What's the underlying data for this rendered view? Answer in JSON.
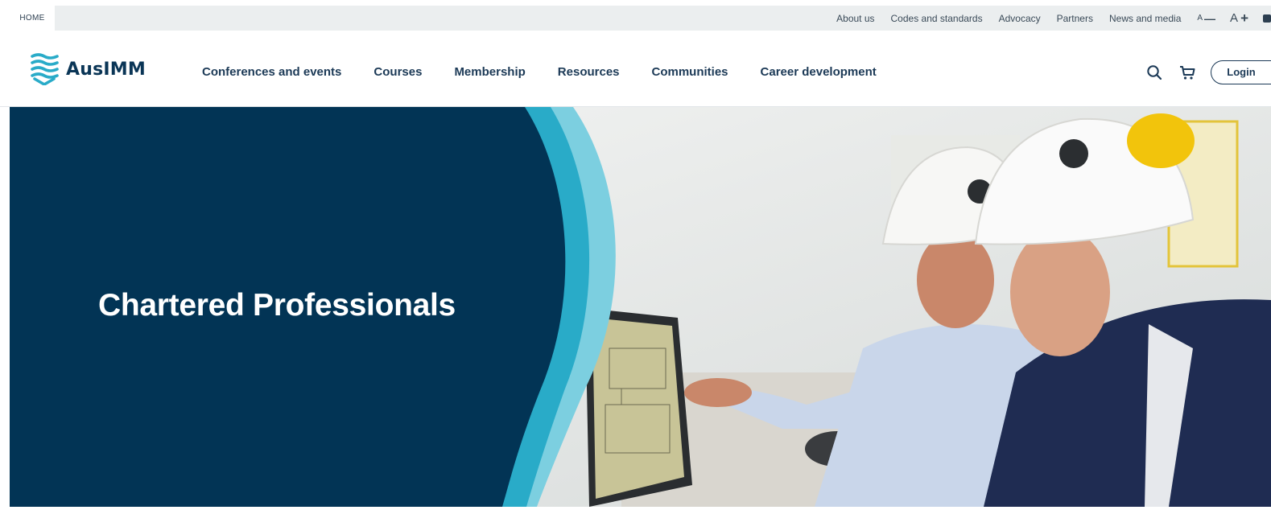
{
  "utility_bar": {
    "home_label": "HOME",
    "links": [
      "About us",
      "Codes and standards",
      "Advocacy",
      "Partners",
      "News and media"
    ],
    "font_decrease": {
      "letter": "A",
      "symbol": "—"
    },
    "font_increase": {
      "letter": "A",
      "symbol": "+"
    }
  },
  "header": {
    "logo_text": "AusIMM",
    "nav": [
      "Conferences and events",
      "Courses",
      "Membership",
      "Resources",
      "Communities",
      "Career development"
    ],
    "login_label": "Login"
  },
  "hero": {
    "title": "Chartered Professionals"
  },
  "colors": {
    "navy": "#023455",
    "teal": "#29abc8",
    "light_teal": "#7ccfe0",
    "utility_bg": "#ebeeef"
  },
  "icons": [
    "search-icon",
    "cart-icon",
    "logo-mark-icon"
  ]
}
